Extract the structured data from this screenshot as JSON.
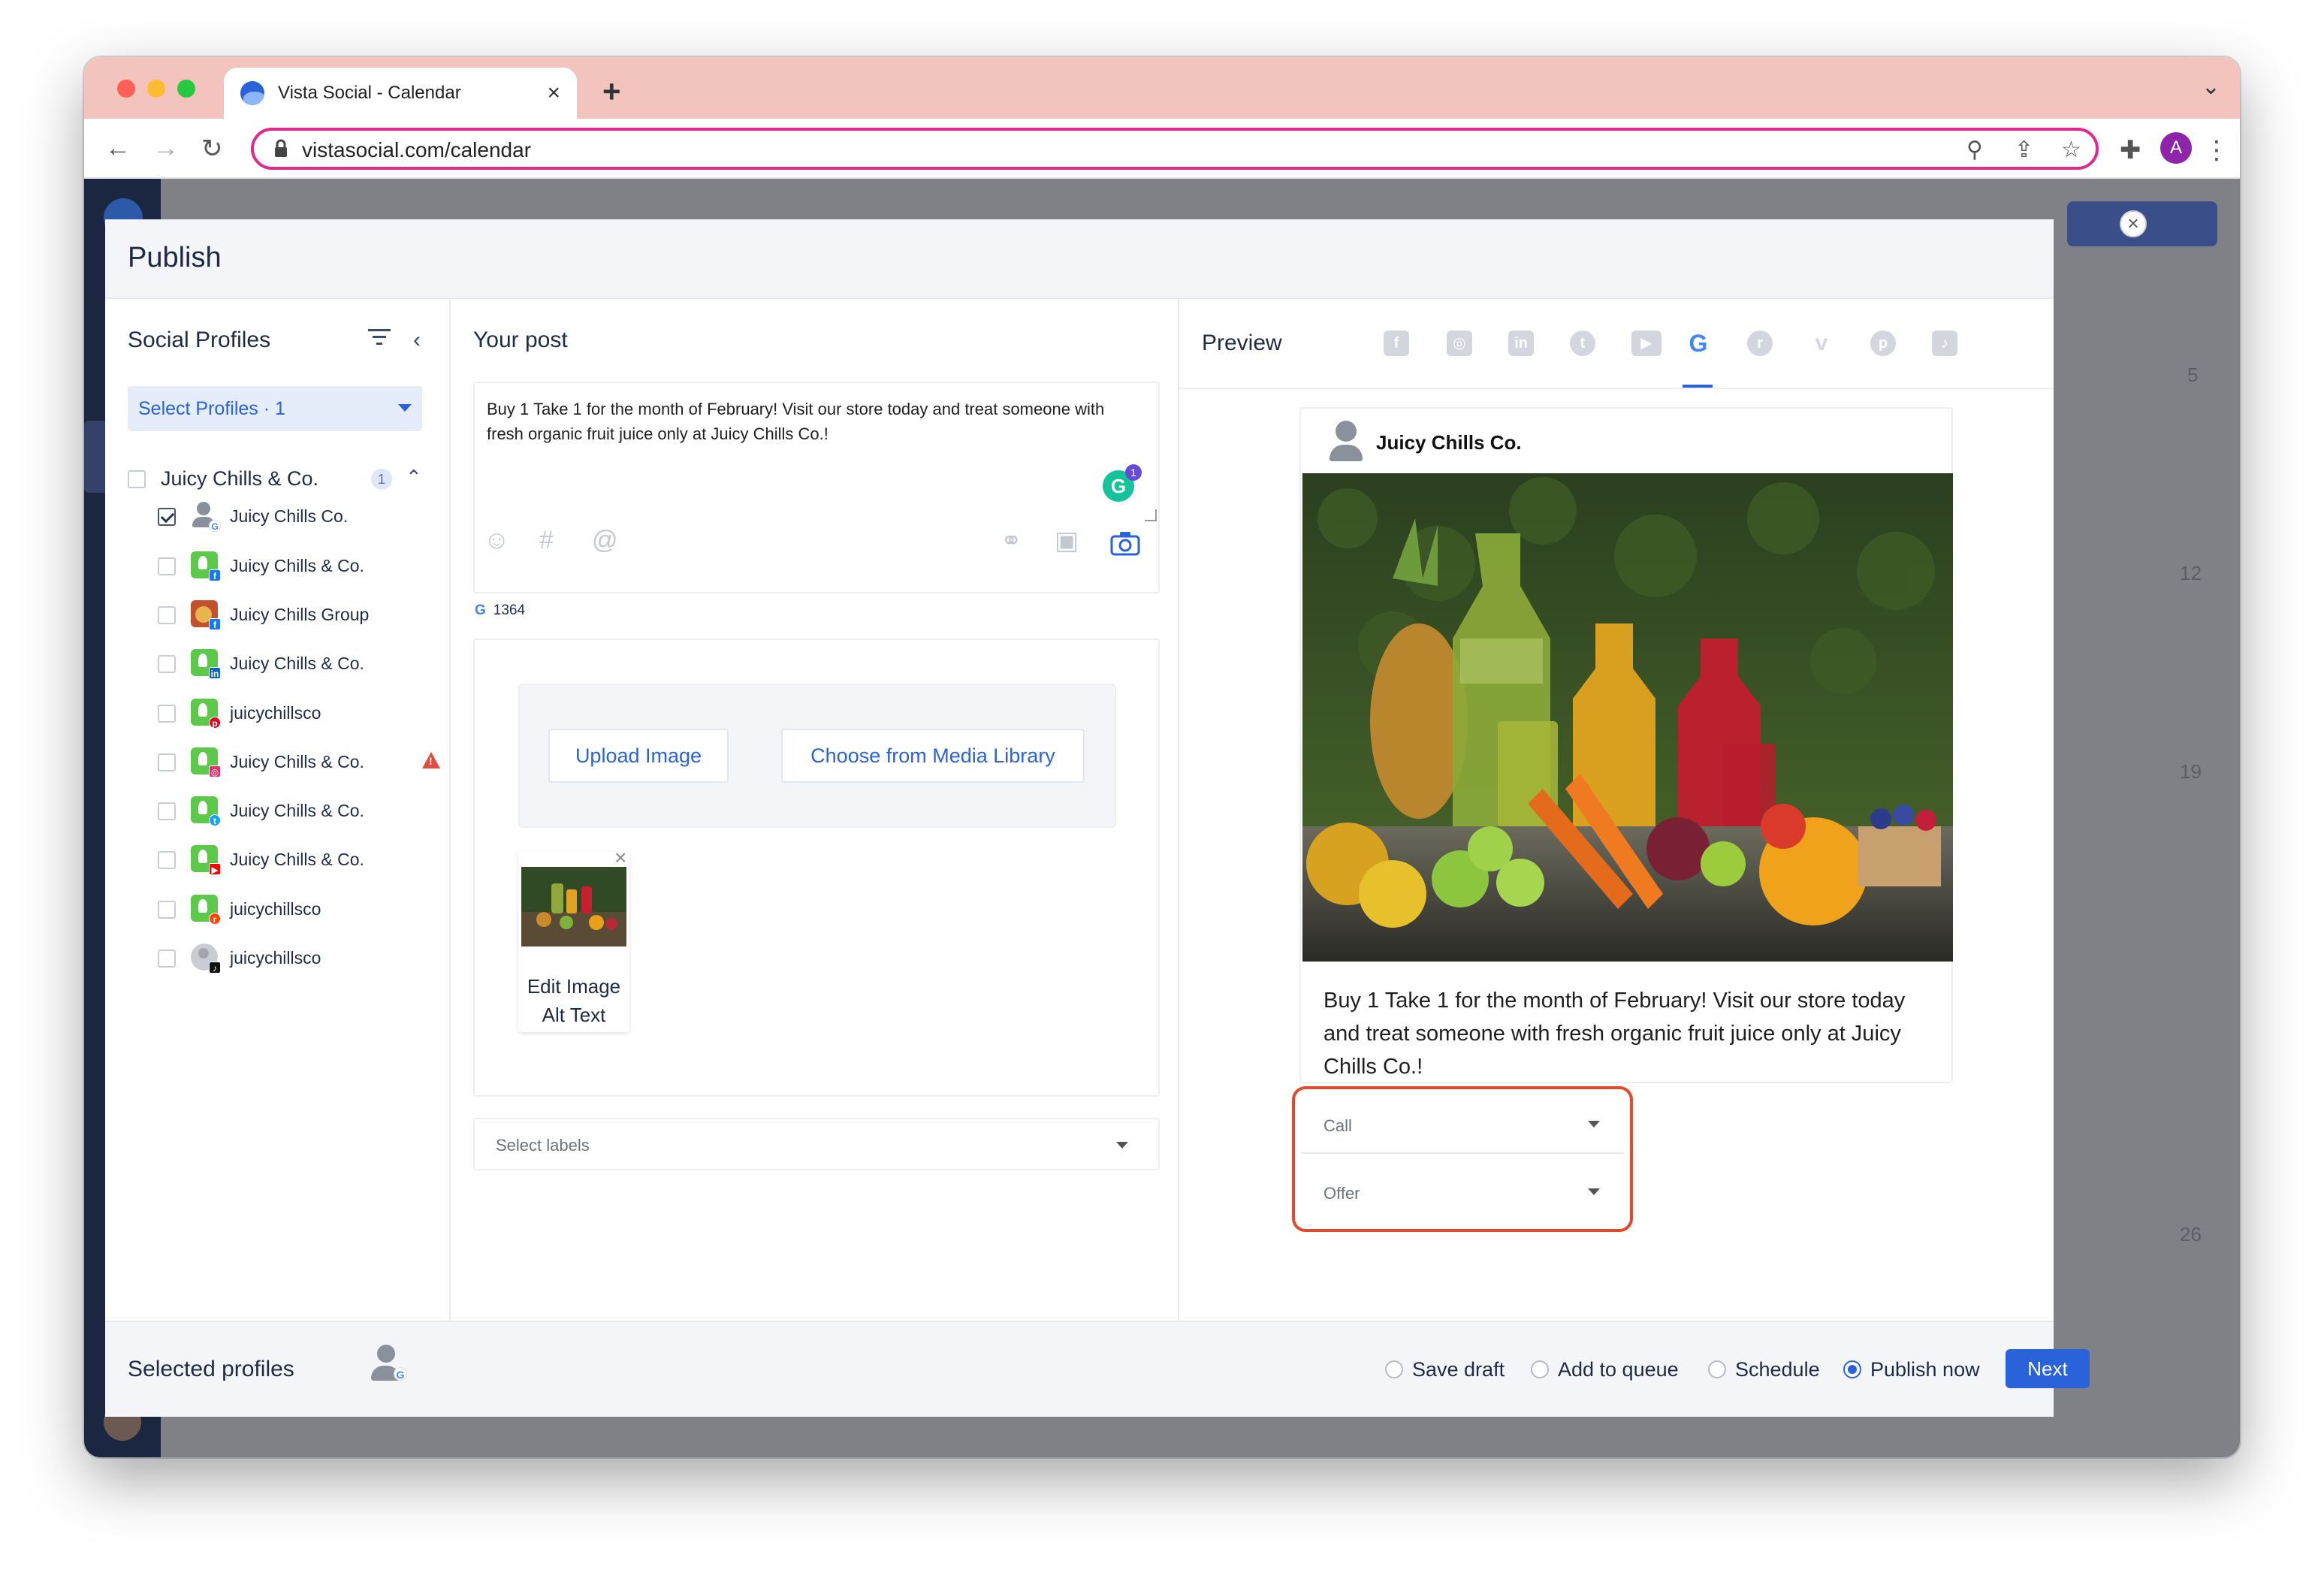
{
  "browser": {
    "tab_title": "Vista Social - Calendar",
    "tab_close": "×",
    "new_tab": "+",
    "url": "vistasocial.com/calendar",
    "profile_initial": "A"
  },
  "modal": {
    "title": "Publish",
    "close_glyph": "×"
  },
  "profiles": {
    "header": "Social Profiles",
    "select_label": "Select Profiles · 1",
    "group": {
      "name": "Juicy Chills & Co.",
      "badge": "1"
    },
    "items": [
      {
        "name": "Juicy Chills Co.",
        "checked": true,
        "network": "google"
      },
      {
        "name": "Juicy Chills & Co.",
        "checked": false,
        "network": "facebook"
      },
      {
        "name": "Juicy Chills Group",
        "checked": false,
        "network": "facebook"
      },
      {
        "name": "Juicy Chills & Co.",
        "checked": false,
        "network": "linkedin"
      },
      {
        "name": "juicychillsco",
        "checked": false,
        "network": "pinterest"
      },
      {
        "name": "Juicy Chills & Co.",
        "checked": false,
        "network": "instagram",
        "warning": true
      },
      {
        "name": "Juicy Chills & Co.",
        "checked": false,
        "network": "twitter"
      },
      {
        "name": "Juicy Chills & Co.",
        "checked": false,
        "network": "youtube"
      },
      {
        "name": "juicychillsco",
        "checked": false,
        "network": "reddit"
      },
      {
        "name": "juicychillsco",
        "checked": false,
        "network": "tiktok"
      }
    ]
  },
  "post": {
    "header": "Your post",
    "text": "Buy 1 Take 1 for the month of February! Visit our store today and treat someone with fresh organic fruit juice only at Juicy Chills Co.!",
    "grammarly_count": "1",
    "char_count": "1364",
    "upload_button": "Upload Image",
    "library_button": "Choose from Media Library",
    "alt_text_label": "Edit Image Alt Text",
    "labels_placeholder": "Select labels"
  },
  "preview": {
    "header": "Preview",
    "networks": [
      "facebook",
      "instagram",
      "linkedin",
      "twitter",
      "youtube",
      "google",
      "reddit",
      "vimeo",
      "pinterest",
      "tiktok"
    ],
    "active_network": "google",
    "card_name": "Juicy Chills Co.",
    "card_text": "Buy 1 Take 1 for the month of February! Visit our store today and treat someone with fresh organic fruit juice only at Juicy Chills Co.!",
    "cta_placeholder": "Call",
    "offer_placeholder": "Offer"
  },
  "footer": {
    "title": "Selected profiles",
    "options": [
      {
        "label": "Save draft",
        "selected": false
      },
      {
        "label": "Add to queue",
        "selected": false
      },
      {
        "label": "Schedule",
        "selected": false
      },
      {
        "label": "Publish now",
        "selected": true
      }
    ],
    "next_label": "Next"
  },
  "background_app": {
    "calendar_days": [
      "5",
      "12",
      "19",
      "26"
    ]
  },
  "colors": {
    "accent": "#2a62d9",
    "sidebar": "#1b2640",
    "highlight": "#e24a2d",
    "titlebar": "#f3c3bd"
  }
}
